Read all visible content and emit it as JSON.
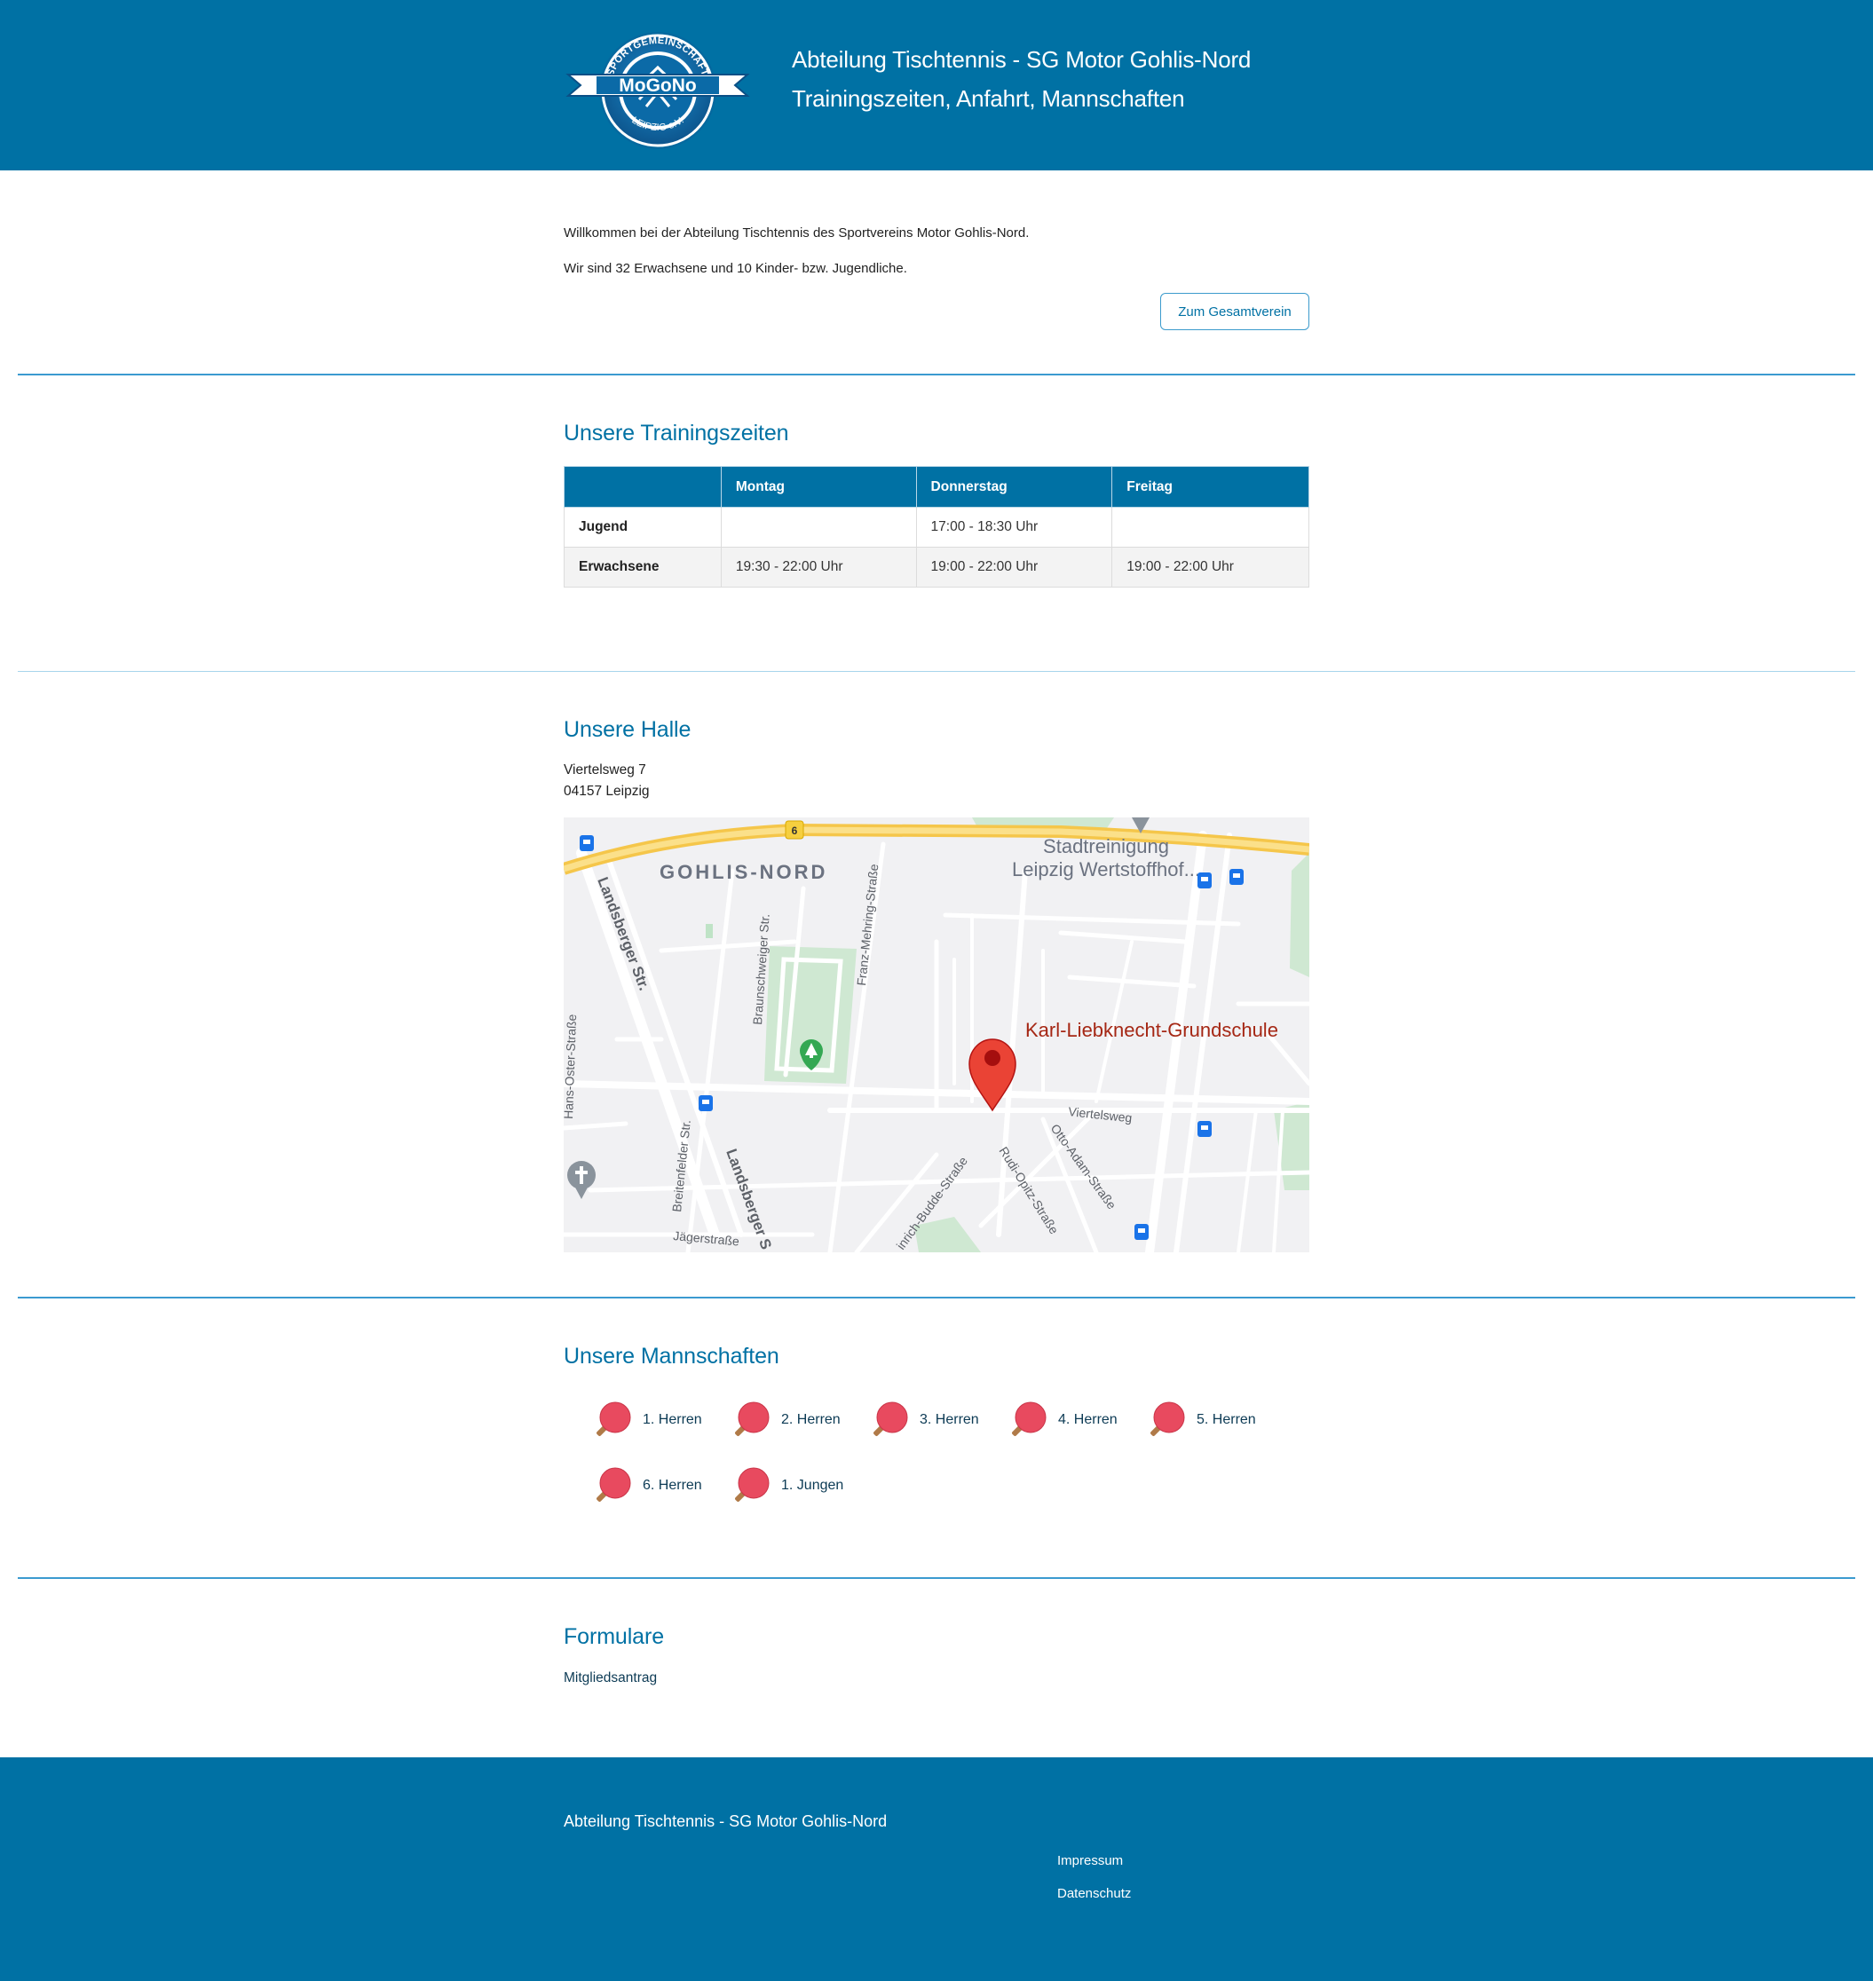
{
  "header": {
    "logo_text": "MoGoNo",
    "logo_arc_top": "SPORTGEMEINSCHAFT",
    "logo_arc_bottom": "LEIPZIG e.V.",
    "title": "Abteilung Tischtennis - SG Motor Gohlis-Nord",
    "subtitle": "Trainingszeiten, Anfahrt, Mannschaften"
  },
  "welcome": {
    "line1": "Willkommen bei der Abteilung Tischtennis des Sportvereins Motor Gohlis-Nord.",
    "line2": "Wir sind 32 Erwachsene und 10 Kinder- bzw. Jugendliche.",
    "button_label": "Zum Gesamtverein"
  },
  "training": {
    "title": "Unsere Trainingszeiten",
    "columns": [
      "",
      "Montag",
      "Donnerstag",
      "Freitag"
    ],
    "rows": [
      [
        "Jugend",
        "",
        "17:00 - 18:30 Uhr",
        ""
      ],
      [
        "Erwachsene",
        "19:30 - 22:00 Uhr",
        "19:00 - 22:00 Uhr",
        "19:00 - 22:00 Uhr"
      ]
    ]
  },
  "hall": {
    "title": "Unsere Halle",
    "street": "Viertelsweg 7",
    "city": "04157 Leipzig",
    "map": {
      "district": "GOHLIS-NORD",
      "poi_name_line1": "Stadtreinigung",
      "poi_name_line2": "Leipzig Wertstoffhof...",
      "marker_label": "Karl-Liebknecht-Grundschule",
      "route_number": "6",
      "streets": [
        "Landsberger Str.",
        "Braunschweiger Str.",
        "Franz-Mehring-Straße",
        "Hans-Oster-Straße",
        "Breitenfelder Str.",
        "Landsberger S",
        "Jägerstraße",
        "Viertelsweg",
        "Otto-Adam-Straße",
        "Rudi-Opitz-Straße",
        "inrich-Budde-Straße"
      ]
    }
  },
  "teams": {
    "title": "Unsere Mannschaften",
    "items": [
      "1. Herren",
      "2. Herren",
      "3. Herren",
      "4. Herren",
      "5. Herren",
      "6. Herren",
      "1. Jungen"
    ]
  },
  "forms": {
    "title": "Formulare",
    "link": "Mitgliedsantrag"
  },
  "footer": {
    "title": "Abteilung Tischtennis - SG Motor Gohlis-Nord",
    "links": [
      "Impressum",
      "Datenschutz"
    ]
  },
  "colors": {
    "brand": "#0071a4",
    "marker": "#e53935",
    "paddle": "#e84a5f"
  }
}
